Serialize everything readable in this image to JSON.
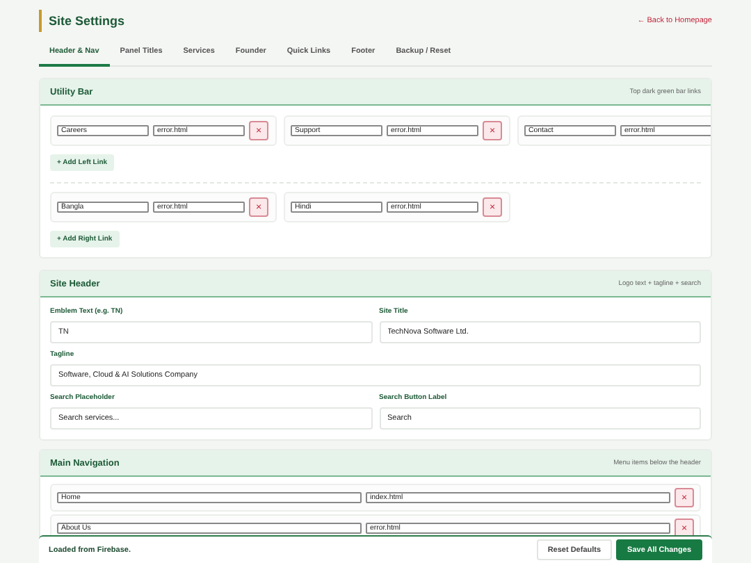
{
  "title": "Site Settings",
  "back_link": "← Back to Homepage",
  "tabs": [
    {
      "label": "Header & Nav",
      "selected": true
    },
    {
      "label": "Panel Titles",
      "selected": false
    },
    {
      "label": "Services",
      "selected": false
    },
    {
      "label": "Founder",
      "selected": false
    },
    {
      "label": "Quick Links",
      "selected": false
    },
    {
      "label": "Footer",
      "selected": false
    },
    {
      "label": "Backup / Reset",
      "selected": false
    }
  ],
  "utility_bar": {
    "title": "Utility Bar",
    "note": "Top dark green bar links",
    "left_links": [
      {
        "label": "Careers",
        "url": "error.html",
        "remove": "×"
      },
      {
        "label": "Support",
        "url": "error.html",
        "remove": "×"
      },
      {
        "label": "Contact",
        "url": "error.html"
      }
    ],
    "add_left": "+ Add Left Link",
    "right_links": [
      {
        "label": "Bangla",
        "url": "error.html",
        "remove": "×"
      },
      {
        "label": "Hindi",
        "url": "error.html",
        "remove": "×"
      }
    ],
    "add_right": "+ Add Right Link"
  },
  "site_header": {
    "title": "Site Header",
    "note": "Logo text + tagline + search",
    "fields": [
      {
        "label": "Emblem Text (e.g. TN)",
        "value": "TN",
        "wide": false
      },
      {
        "label": "Site Title",
        "value": "TechNova Software Ltd.",
        "wide": false
      },
      {
        "label": "Tagline",
        "value": "Software, Cloud & AI Solutions Company",
        "wide": true
      },
      {
        "label": "Search Placeholder",
        "value": "Search services...",
        "wide": false
      },
      {
        "label": "Search Button Label",
        "value": "Search",
        "wide": false
      }
    ]
  },
  "main_navigation": {
    "title": "Main Navigation",
    "note": "Menu items below the header",
    "items": [
      {
        "label": "Home",
        "url": "index.html",
        "remove": "×"
      },
      {
        "label": "About Us",
        "url": "error.html",
        "remove": "×"
      }
    ]
  },
  "footer": {
    "status": "Loaded from Firebase.",
    "buttons": [
      {
        "label": "Reset Defaults",
        "kind": "secondary"
      },
      {
        "label": "Save All Changes",
        "kind": "primary"
      }
    ]
  }
}
